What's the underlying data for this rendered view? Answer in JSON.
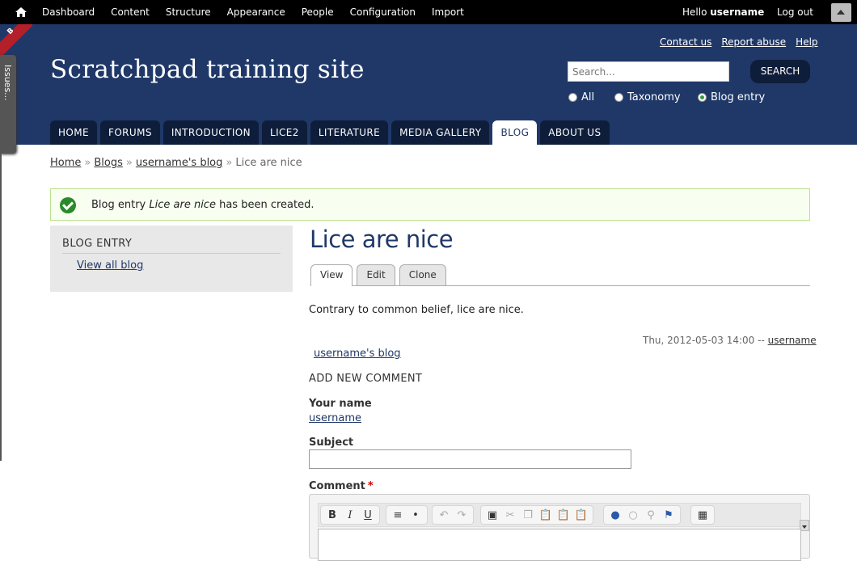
{
  "admin_bar": {
    "menu": [
      "Dashboard",
      "Content",
      "Structure",
      "Appearance",
      "People",
      "Configuration",
      "Import"
    ],
    "hello_prefix": "Hello",
    "hello_user": "username",
    "logout": "Log out"
  },
  "ribbon_text": "B",
  "issues_tab": "Issues...",
  "header": {
    "site_name": "Scratchpad training site",
    "top_links": [
      "Contact us",
      "Report abuse",
      "Help"
    ],
    "search_placeholder": "Search...",
    "search_button": "SEARCH",
    "search_scope": [
      {
        "label": "All",
        "selected": false
      },
      {
        "label": "Taxonomy",
        "selected": false
      },
      {
        "label": "Blog entry",
        "selected": true
      }
    ],
    "nav": [
      "HOME",
      "FORUMS",
      "INTRODUCTION",
      "LICE2",
      "LITERATURE",
      "MEDIA GALLERY",
      "BLOG",
      "ABOUT US"
    ],
    "nav_active": "BLOG"
  },
  "breadcrumb": {
    "links": [
      "Home",
      "Blogs",
      "username's blog"
    ],
    "current": "Lice are nice",
    "separator": "»"
  },
  "status": {
    "before": "Blog entry ",
    "title": "Lice are nice",
    "after": " has been created."
  },
  "sidebar": {
    "title": "BLOG ENTRY",
    "link": "View all blog"
  },
  "main": {
    "title": "Lice are nice",
    "tabs": [
      "View",
      "Edit",
      "Clone"
    ],
    "active_tab": "View",
    "body": "Contrary to common belief, lice are nice.",
    "submitted": "Thu, 2012-05-03 14:00 --",
    "author": "username",
    "blog_link": "username's blog"
  },
  "comment_form": {
    "heading": "ADD NEW COMMENT",
    "your_name_label": "Your name",
    "your_name_value": "username",
    "subject_label": "Subject",
    "comment_label": "Comment",
    "required_mark": "*"
  },
  "colors": {
    "header_bg": "#1f3868",
    "nav_tab_bg": "#0e1d3a",
    "status_bg": "#f8fff0",
    "status_border": "#bbe08e"
  }
}
